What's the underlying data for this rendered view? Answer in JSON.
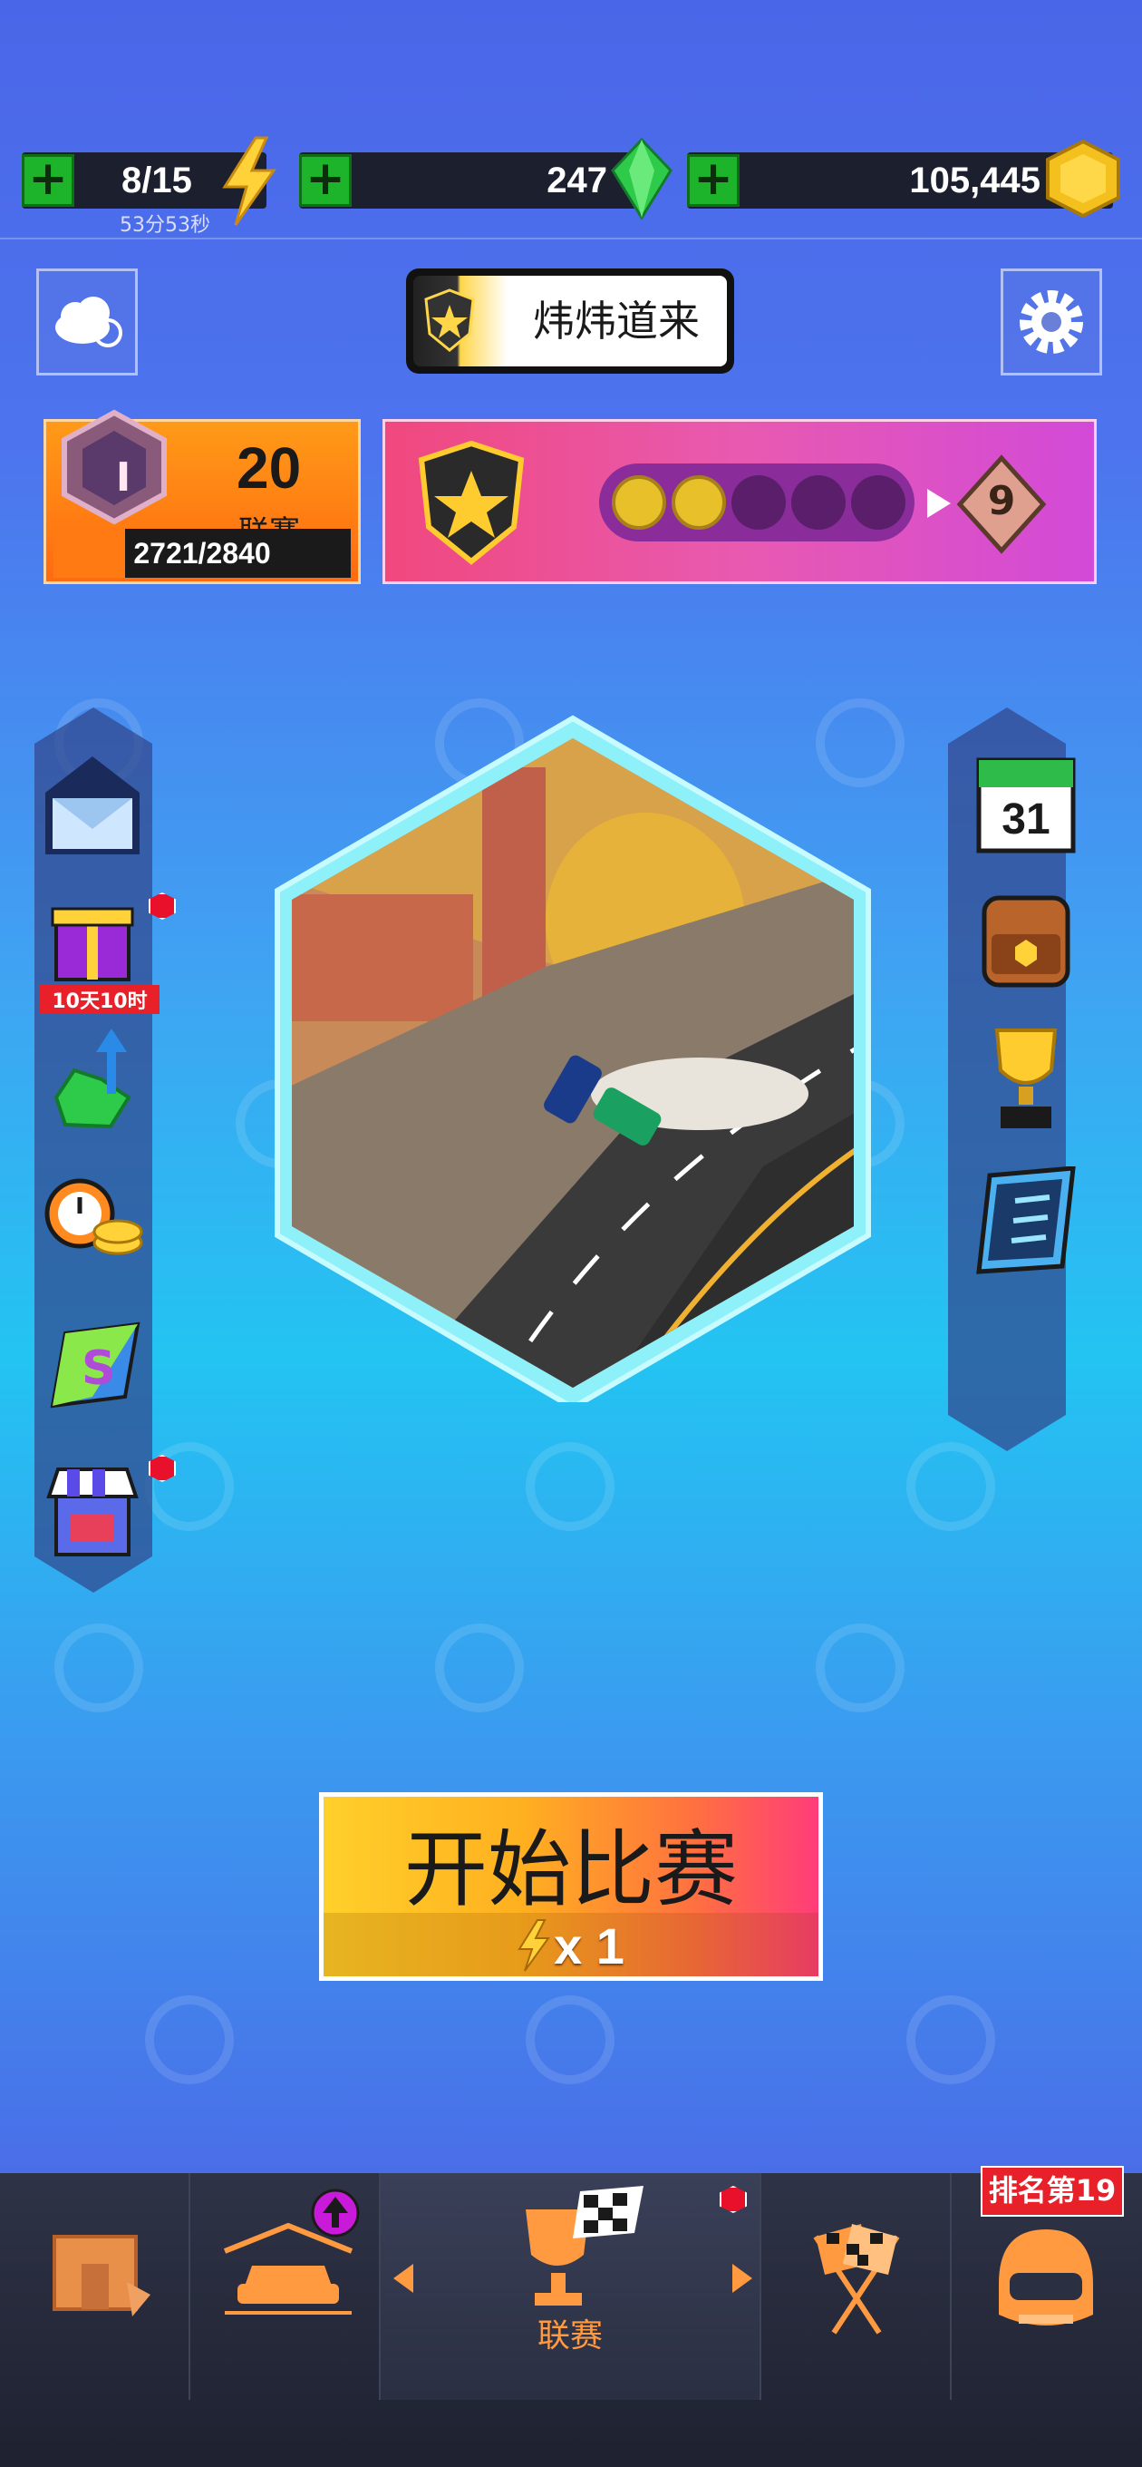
{
  "resources": {
    "energy": {
      "value": "8/15",
      "timer": "53分53秒"
    },
    "gems": {
      "value": "247"
    },
    "coins": {
      "value": "105,445"
    }
  },
  "player": {
    "name": "炜炜道来"
  },
  "league": {
    "rank_letter": "I",
    "level": "20",
    "label": "联赛",
    "progress_text": "2721/2840",
    "progress_fraction": 0.958
  },
  "rank_track": {
    "stars_filled": 2,
    "stars_total": 5,
    "next_rank": "9"
  },
  "left_menu": [
    {
      "name": "mail",
      "badge": ""
    },
    {
      "name": "gift",
      "badge": "10天10时"
    },
    {
      "name": "gem-upgrade",
      "badge": ""
    },
    {
      "name": "coin-timer",
      "badge": ""
    },
    {
      "name": "season-pass",
      "badge": ""
    },
    {
      "name": "shop",
      "badge": ""
    }
  ],
  "right_menu": [
    {
      "name": "calendar",
      "label": "31"
    },
    {
      "name": "backpack",
      "label": ""
    },
    {
      "name": "trophy",
      "label": ""
    },
    {
      "name": "tasks",
      "label": ""
    }
  ],
  "start_button": {
    "label": "开始比赛",
    "cost": "x 1"
  },
  "bottom_nav": {
    "items": [
      {
        "name": "garage-store",
        "label": ""
      },
      {
        "name": "cars",
        "label": ""
      },
      {
        "name": "league",
        "label": "联赛"
      },
      {
        "name": "race",
        "label": ""
      },
      {
        "name": "profile",
        "label": ""
      }
    ],
    "rank_badge": "排名第19"
  },
  "colors": {
    "accent_orange": "#ff9a40",
    "plus_green": "#1db32a",
    "badge_red": "#e8202a"
  }
}
